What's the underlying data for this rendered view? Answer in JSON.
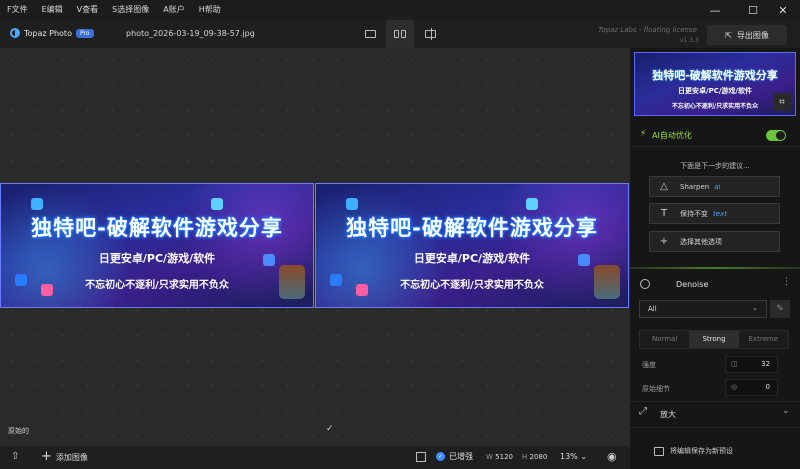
{
  "menu": [
    "F文件",
    "E编辑",
    "V查看",
    "S选择图像",
    "A账户",
    "H帮助"
  ],
  "window_controls": {
    "minimize": "—",
    "maximize": "☐",
    "close": "✕"
  },
  "toolbar": {
    "logo_text": "Topaz Photo",
    "pro_badge": "Pro",
    "filename": "photo_2026-03-19_09-38-57.jpg",
    "license": "Topaz Labs - floating license",
    "version": "v1.3.3",
    "export_label": "导出图像"
  },
  "image": {
    "title": "独特吧-破解软件游戏分享",
    "subtitle": "日更安卓/PC/游戏/软件",
    "tagline": "不忘初心不逐利/只求实用不负众"
  },
  "canvas": {
    "original_label": "原始的",
    "check": "✓"
  },
  "bottombar": {
    "add_image": "添加图像",
    "enhancer": "已增强",
    "width_label": "W",
    "width_value": "5120",
    "height_label": "H",
    "height_value": "2080",
    "zoom": "13%"
  },
  "panel": {
    "ai_label": "AI自动优化",
    "suggest_header": "下面是下一步的建议...",
    "suggestions": [
      {
        "label": "Sharpen",
        "tag": "ai"
      },
      {
        "label": "保持不变",
        "tag": "text"
      },
      {
        "label": "选择其他选项",
        "tag": ""
      }
    ],
    "denoise": {
      "title": "Denoise",
      "model": "All",
      "modes": [
        "Normal",
        "Strong",
        "Extreme"
      ],
      "active_mode": "Strong",
      "params": [
        {
          "label": "强度",
          "value": "32"
        },
        {
          "label": "原始细节",
          "value": "0"
        }
      ]
    },
    "enlarge_title": "放大",
    "save_preset": "将编辑保存为新预设"
  },
  "colors": {
    "accent": "#6cc23a",
    "blue": "#3f8cff"
  }
}
